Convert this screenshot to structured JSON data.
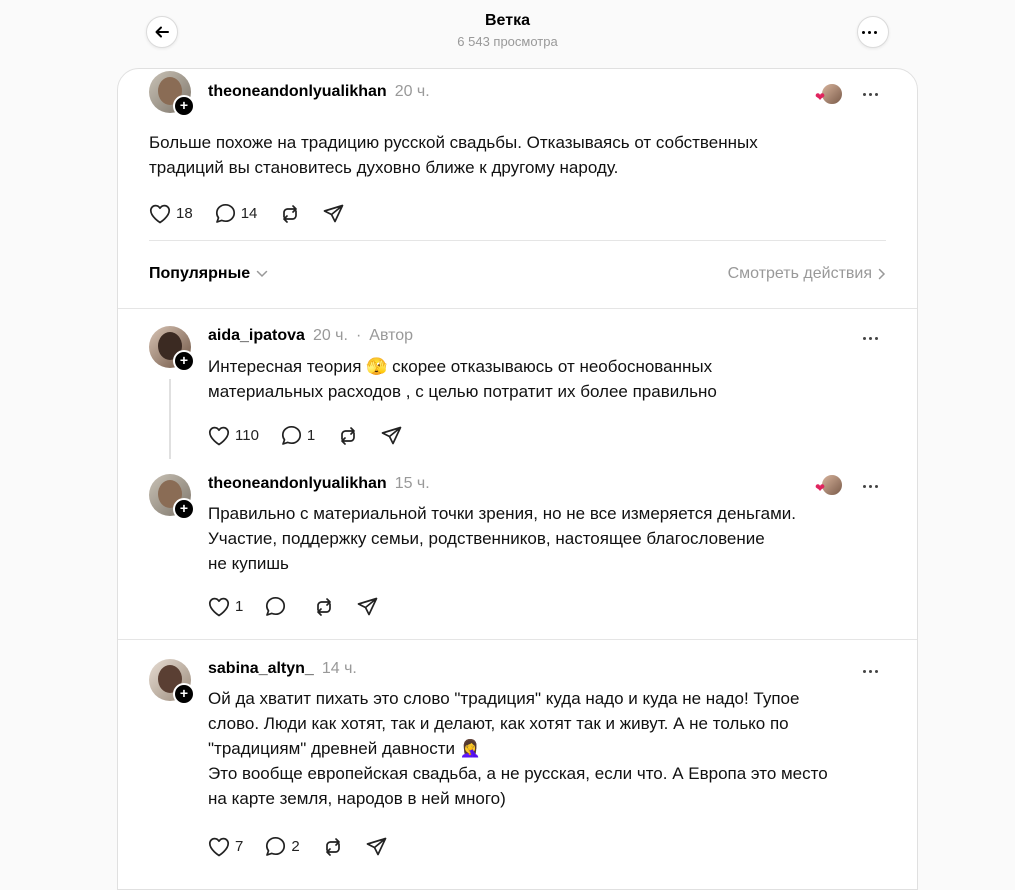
{
  "header": {
    "title": "Ветка",
    "views": "6 543 просмотра"
  },
  "main_post": {
    "username": "theoneandonlyualikhan",
    "time": "20 ч.",
    "text_line1": "Больше похоже на традицию русской свадьбы. Отказываясь от собственных",
    "text_line2": "традиций вы становитесь духовно ближе к другому народу.",
    "likes": "18",
    "comments": "14"
  },
  "sort_bar": {
    "sort_label": "Популярные",
    "see_actions_label": "Смотреть действия"
  },
  "replies": [
    {
      "username": "aida_ipatova",
      "time": "20 ч.",
      "separator": "·",
      "author_label": "Автор",
      "line1": "Интересная теория 🫣 скорее отказываюсь от необоснованных",
      "line2": "материальных расходов , с целью потратит их более правильно",
      "likes": "110",
      "comments": "1"
    },
    {
      "username": "theoneandonlyualikhan",
      "time": "15 ч.",
      "line1": "Правильно с материальной точки зрения, но не все измеряется деньгами.",
      "line2": "Участие, поддержку семьи, родственников, настоящее благословение",
      "line3": "не купишь",
      "likes": "1",
      "comments": ""
    },
    {
      "username": "sabina_altyn_",
      "time": "14 ч.",
      "line1": "Ой да хватит пихать это слово \"традиция\" куда надо и куда не надо! Тупое",
      "line2": "слово. Люди как хотят, так и делают, как хотят так и живут. А не только по",
      "line3": "\"традициям\" древней давности 🤦‍♀️",
      "line4": "Это вообще европейская свадьба, а не русская, если что. А Европа это место",
      "line5": "на карте земля, народов в ней много)",
      "likes": "7",
      "comments": "2"
    }
  ],
  "colors": {
    "background": "#fafafa",
    "card": "#ffffff",
    "secondary_text": "#999999",
    "heart_reaction": "#e0245e"
  },
  "icons": [
    "back-arrow-icon",
    "more-icon",
    "heart-icon",
    "comment-icon",
    "repost-icon",
    "share-icon",
    "chevron-down-icon",
    "chevron-right-icon",
    "plus-icon"
  ]
}
